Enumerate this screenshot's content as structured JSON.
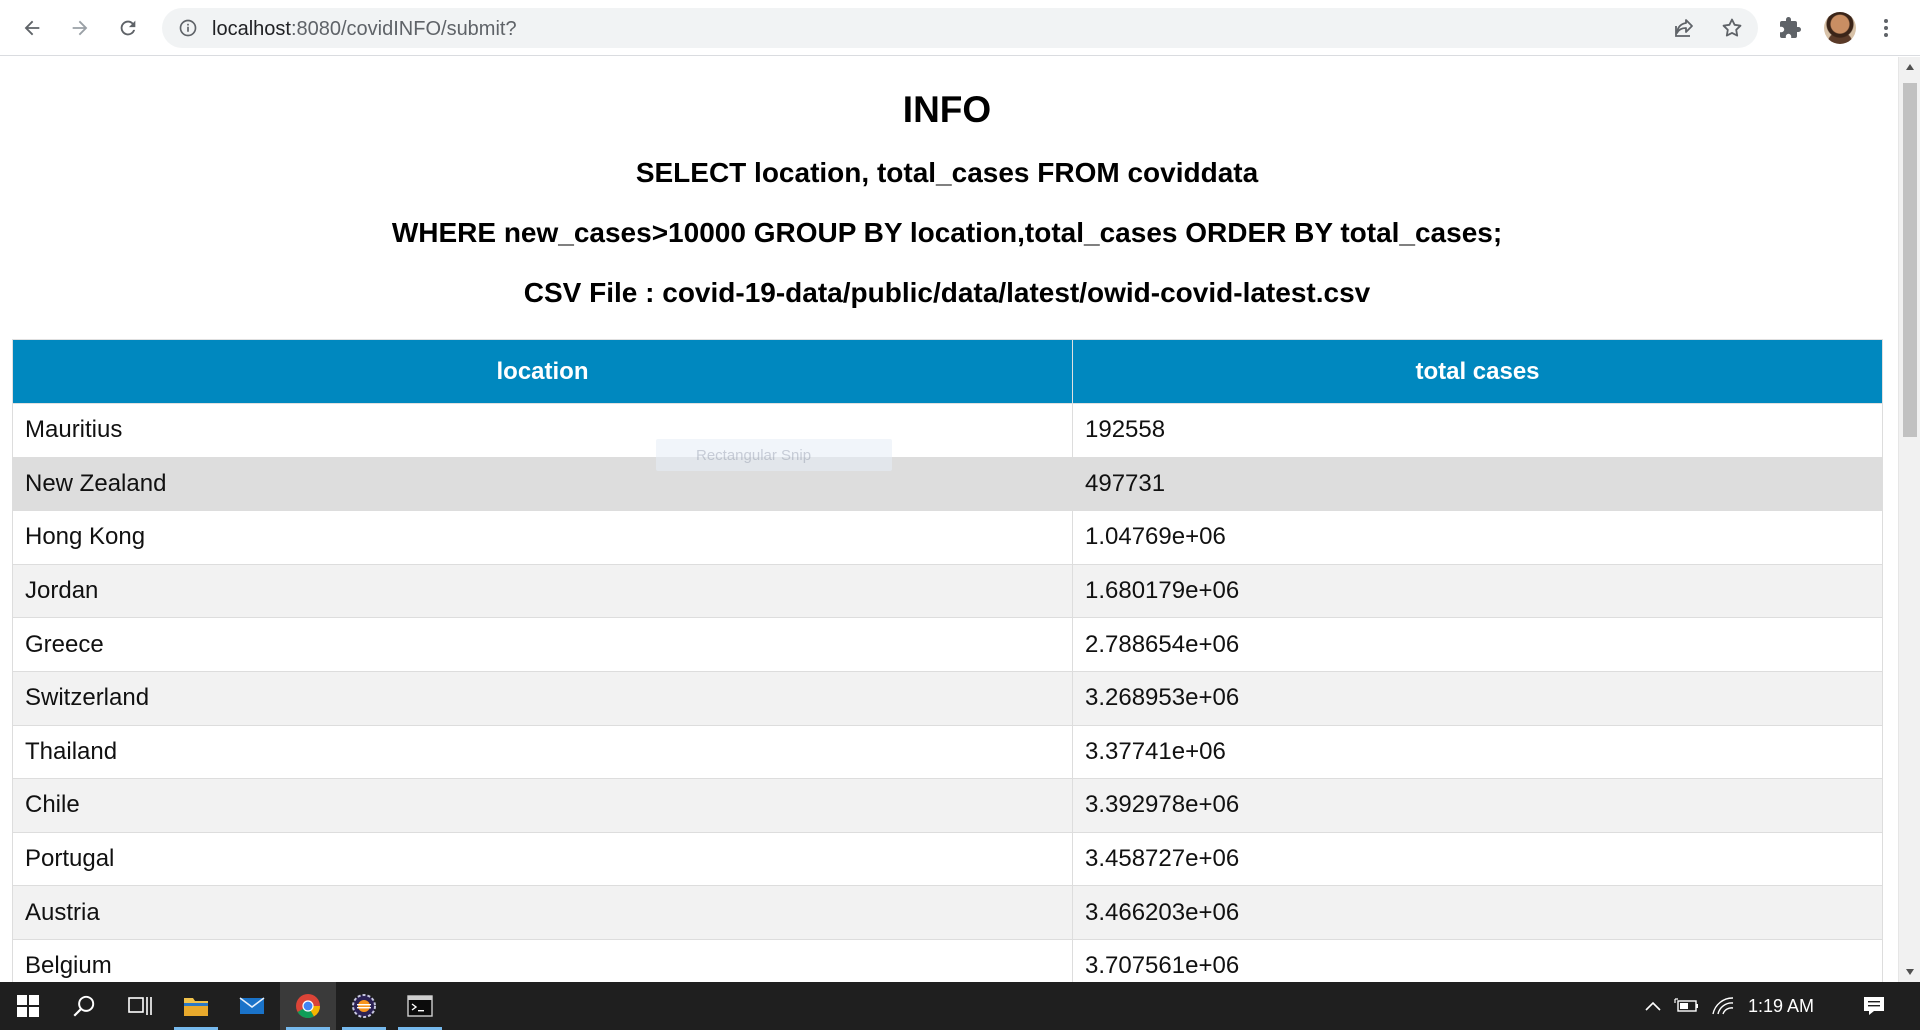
{
  "browser": {
    "url_host": "localhost",
    "url_path": ":8080/covidINFO/submit?"
  },
  "page": {
    "title": "INFO",
    "query_line_1": "SELECT location, total_cases FROM coviddata",
    "query_line_2": "WHERE new_cases>10000 GROUP BY location,total_cases ORDER BY total_cases;",
    "csv_line": "CSV File : covid-19-data/public/data/latest/owid-covid-latest.csv"
  },
  "table": {
    "headers": [
      "location",
      "total cases"
    ],
    "rows": [
      {
        "location": "Mauritius",
        "total_cases": "192558"
      },
      {
        "location": "New Zealand",
        "total_cases": "497731"
      },
      {
        "location": "Hong Kong",
        "total_cases": "1.04769e+06"
      },
      {
        "location": "Jordan",
        "total_cases": "1.680179e+06"
      },
      {
        "location": "Greece",
        "total_cases": "2.788654e+06"
      },
      {
        "location": "Switzerland",
        "total_cases": "3.268953e+06"
      },
      {
        "location": "Thailand",
        "total_cases": "3.37741e+06"
      },
      {
        "location": "Chile",
        "total_cases": "3.392978e+06"
      },
      {
        "location": "Portugal",
        "total_cases": "3.458727e+06"
      },
      {
        "location": "Austria",
        "total_cases": "3.466203e+06"
      },
      {
        "location": "Belgium",
        "total_cases": "3.707561e+06"
      }
    ]
  },
  "overlay": {
    "snip_label": "Rectangular Snip"
  },
  "taskbar": {
    "clock": "1:19 AM"
  },
  "colors": {
    "table_header": "#0088bf",
    "row_alt": "#f2f2f2",
    "row_hover": "#dddddd",
    "taskbar": "#1f1f1f"
  },
  "icons": {
    "back": "arrow-left-icon",
    "forward": "arrow-right-icon",
    "reload": "reload-icon",
    "site_info": "info-icon",
    "share": "share-icon",
    "bookmark": "star-icon",
    "extensions": "puzzle-icon",
    "menu": "kebab-menu-icon"
  }
}
